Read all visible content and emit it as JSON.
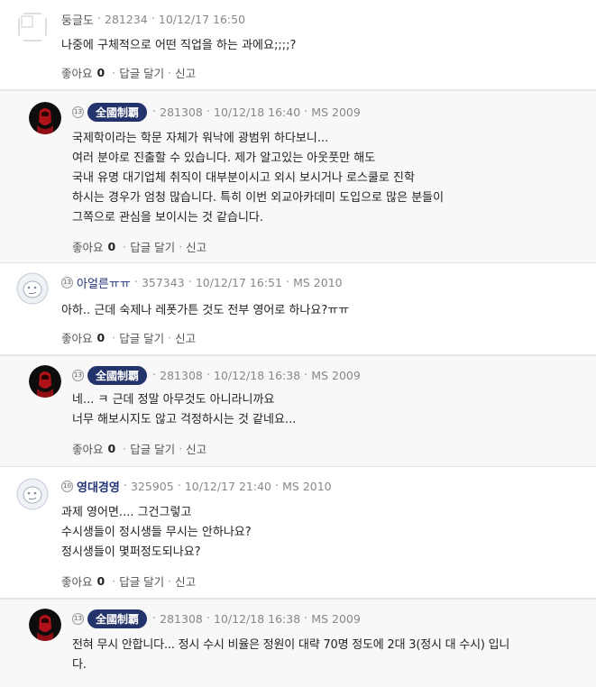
{
  "comments": [
    {
      "nick": "둥글도",
      "level": "",
      "user_id": "281234",
      "datetime": "10/12/17 16:50",
      "class_of": "",
      "lines": [
        "나중에 구체적으로 어떤 직업을 하는 과에요;;;;?"
      ],
      "like_label": "좋아요",
      "like_count": "0",
      "reply_label": "답글 달기",
      "report_label": "신고"
    },
    {
      "nick": "全國制覇",
      "level": "13",
      "user_id": "281308",
      "datetime": "10/12/18 16:40",
      "class_of": "MS 2009",
      "lines": [
        "국제학이라는 학문 자체가 워낙에 광범위 하다보니...",
        "여러 분야로 진출할 수 있습니다. 제가 알고있는 아웃풋만 해도",
        "국내 유명 대기업체 취직이 대부분이시고 외시 보시거나 로스쿨로 진학",
        "하시는 경우가 엄청 많습니다. 특히 이번 외교아카데미 도입으로 많은 분들이",
        "그쪽으로 관심을 보이시는 것 같습니다."
      ],
      "like_label": "좋아요",
      "like_count": "0",
      "reply_label": "답글 달기",
      "report_label": "신고"
    },
    {
      "nick": "아얼른ㅠㅠ",
      "level": "13",
      "user_id": "357343",
      "datetime": "10/12/17 16:51",
      "class_of": "MS 2010",
      "lines": [
        "아하.. 근데 숙제나 레폿가튼 것도 전부 영어로 하나요?ㅠㅠ"
      ],
      "like_label": "좋아요",
      "like_count": "0",
      "reply_label": "답글 달기",
      "report_label": "신고"
    },
    {
      "nick": "全國制覇",
      "level": "13",
      "user_id": "281308",
      "datetime": "10/12/18 16:38",
      "class_of": "MS 2009",
      "lines": [
        "네... ㅋ 근데 정말 아무것도 아니라니까요",
        "너무 해보시지도 않고 걱정하시는 것 같네요..."
      ],
      "like_label": "좋아요",
      "like_count": "0",
      "reply_label": "답글 달기",
      "report_label": "신고"
    },
    {
      "nick": "영대경영",
      "level": "10",
      "user_id": "325905",
      "datetime": "10/12/17 21:40",
      "class_of": "MS 2010",
      "lines": [
        "과제 영어면.... 그건그렇고",
        "수시생들이 정시생들 무시는 안하나요?",
        "정시생들이 몇퍼정도되나요?"
      ],
      "like_label": "좋아요",
      "like_count": "0",
      "reply_label": "답글 달기",
      "report_label": "신고"
    },
    {
      "nick": "全國制覇",
      "level": "13",
      "user_id": "281308",
      "datetime": "10/12/18 16:38",
      "class_of": "MS 2009",
      "lines": [
        "전혀 무시 안합니다... 정시 수시 비율은 정원이 대략 70명 정도에 2대 3(정시 대 수시) 입니",
        "다."
      ]
    }
  ]
}
